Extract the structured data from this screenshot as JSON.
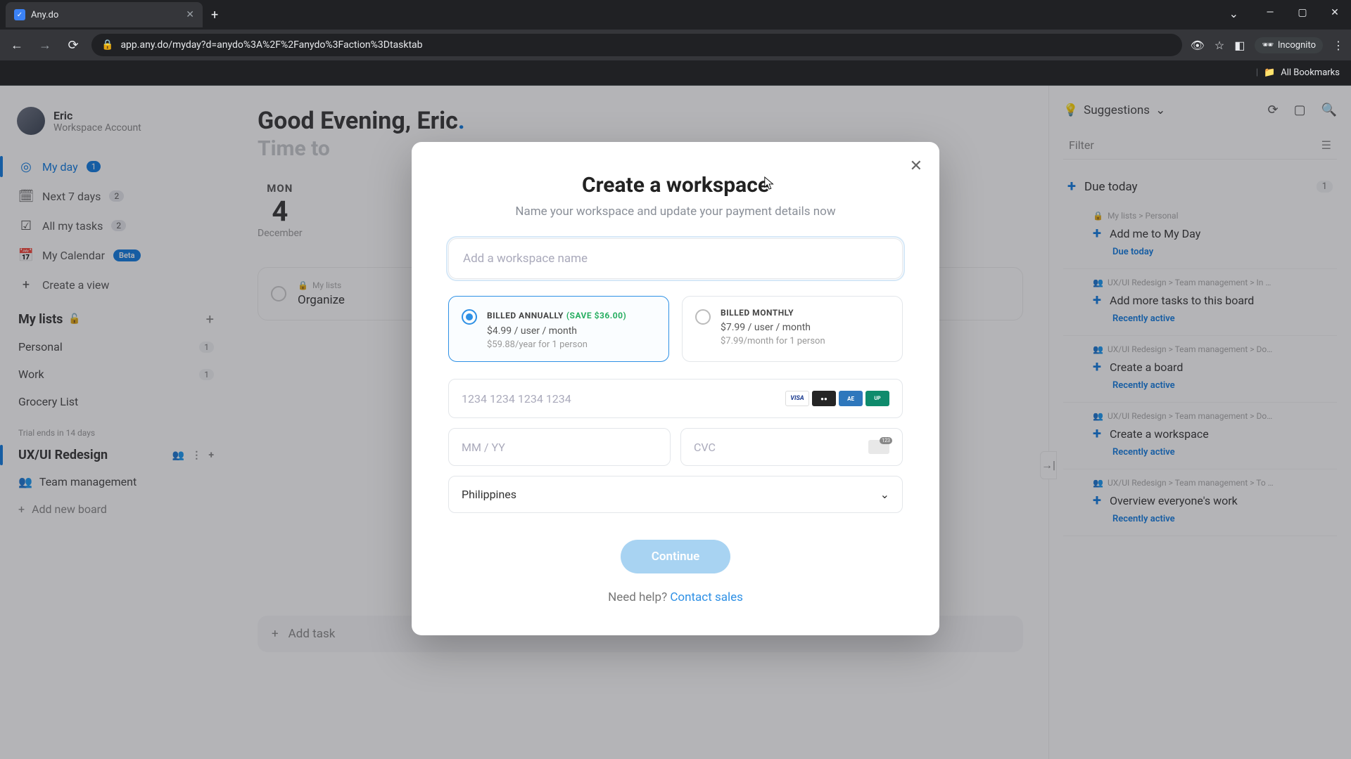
{
  "browser": {
    "tab_title": "Any.do",
    "url_display": "app.any.do/myday?d=anydo%3A%2F%2Fanydo%3Faction%3Dtasktab",
    "incognito_label": "Incognito",
    "bookmarks_label": "All Bookmarks"
  },
  "sidebar": {
    "user_name": "Eric",
    "user_subtitle": "Workspace Account",
    "nav": [
      {
        "label": "My day",
        "badge": "1",
        "active": true
      },
      {
        "label": "Next 7 days",
        "badge": "2"
      },
      {
        "label": "All my tasks",
        "badge": "2"
      },
      {
        "label": "My Calendar",
        "beta": "Beta"
      },
      {
        "label": "Create a view"
      }
    ],
    "lists_title": "My lists",
    "lists": [
      {
        "label": "Personal",
        "count": "1"
      },
      {
        "label": "Work",
        "count": "1"
      },
      {
        "label": "Grocery List"
      }
    ],
    "trial_note": "Trial ends in 14 days",
    "workspace_name": "UX/UI Redesign",
    "boards": [
      {
        "label": "Team management",
        "emoji": "👥"
      }
    ],
    "add_board_label": "Add new board"
  },
  "main": {
    "greeting": "Good Evening, Eric",
    "subgreeting": "Time to",
    "day": {
      "name": "MON",
      "num": "4",
      "month": "December"
    },
    "task_crumb": "My lists",
    "task_title": "Organize",
    "add_task_placeholder": "Add task"
  },
  "right_panel": {
    "suggestions_label": "Suggestions",
    "filter_label": "Filter",
    "due_today_label": "Due today",
    "due_today_count": "1",
    "cards": [
      {
        "crumb": "My lists > Personal",
        "title": "Add me to My Day",
        "status": "Due today"
      },
      {
        "crumb": "UX/UI Redesign > Team management > In …",
        "title": "Add more tasks to this board",
        "status": "Recently active"
      },
      {
        "crumb": "UX/UI Redesign > Team management > Do…",
        "title": "Create a board",
        "status": "Recently active"
      },
      {
        "crumb": "UX/UI Redesign > Team management > Do…",
        "title": "Create a workspace",
        "status": "Recently active"
      },
      {
        "crumb": "UX/UI Redesign > Team management > To …",
        "title": "Overview everyone's work",
        "status": "Recently active"
      }
    ]
  },
  "modal": {
    "title": "Create a workspace",
    "subtitle": "Name your workspace and update your payment details now",
    "name_placeholder": "Add a workspace name",
    "plans": {
      "annual": {
        "label": "BILLED ANNUALLY",
        "save": "(SAVE $36.00)",
        "price": "$4.99 / user / month",
        "total": "$59.88/year for 1 person"
      },
      "monthly": {
        "label": "BILLED MONTHLY",
        "price": "$7.99 / user / month",
        "total": "$7.99/month for 1 person"
      }
    },
    "card_placeholder": "1234 1234 1234 1234",
    "expiry_placeholder": "MM / YY",
    "cvc_placeholder": "CVC",
    "country": "Philippines",
    "continue_label": "Continue",
    "help_prefix": "Need help? ",
    "help_link": "Contact sales"
  }
}
